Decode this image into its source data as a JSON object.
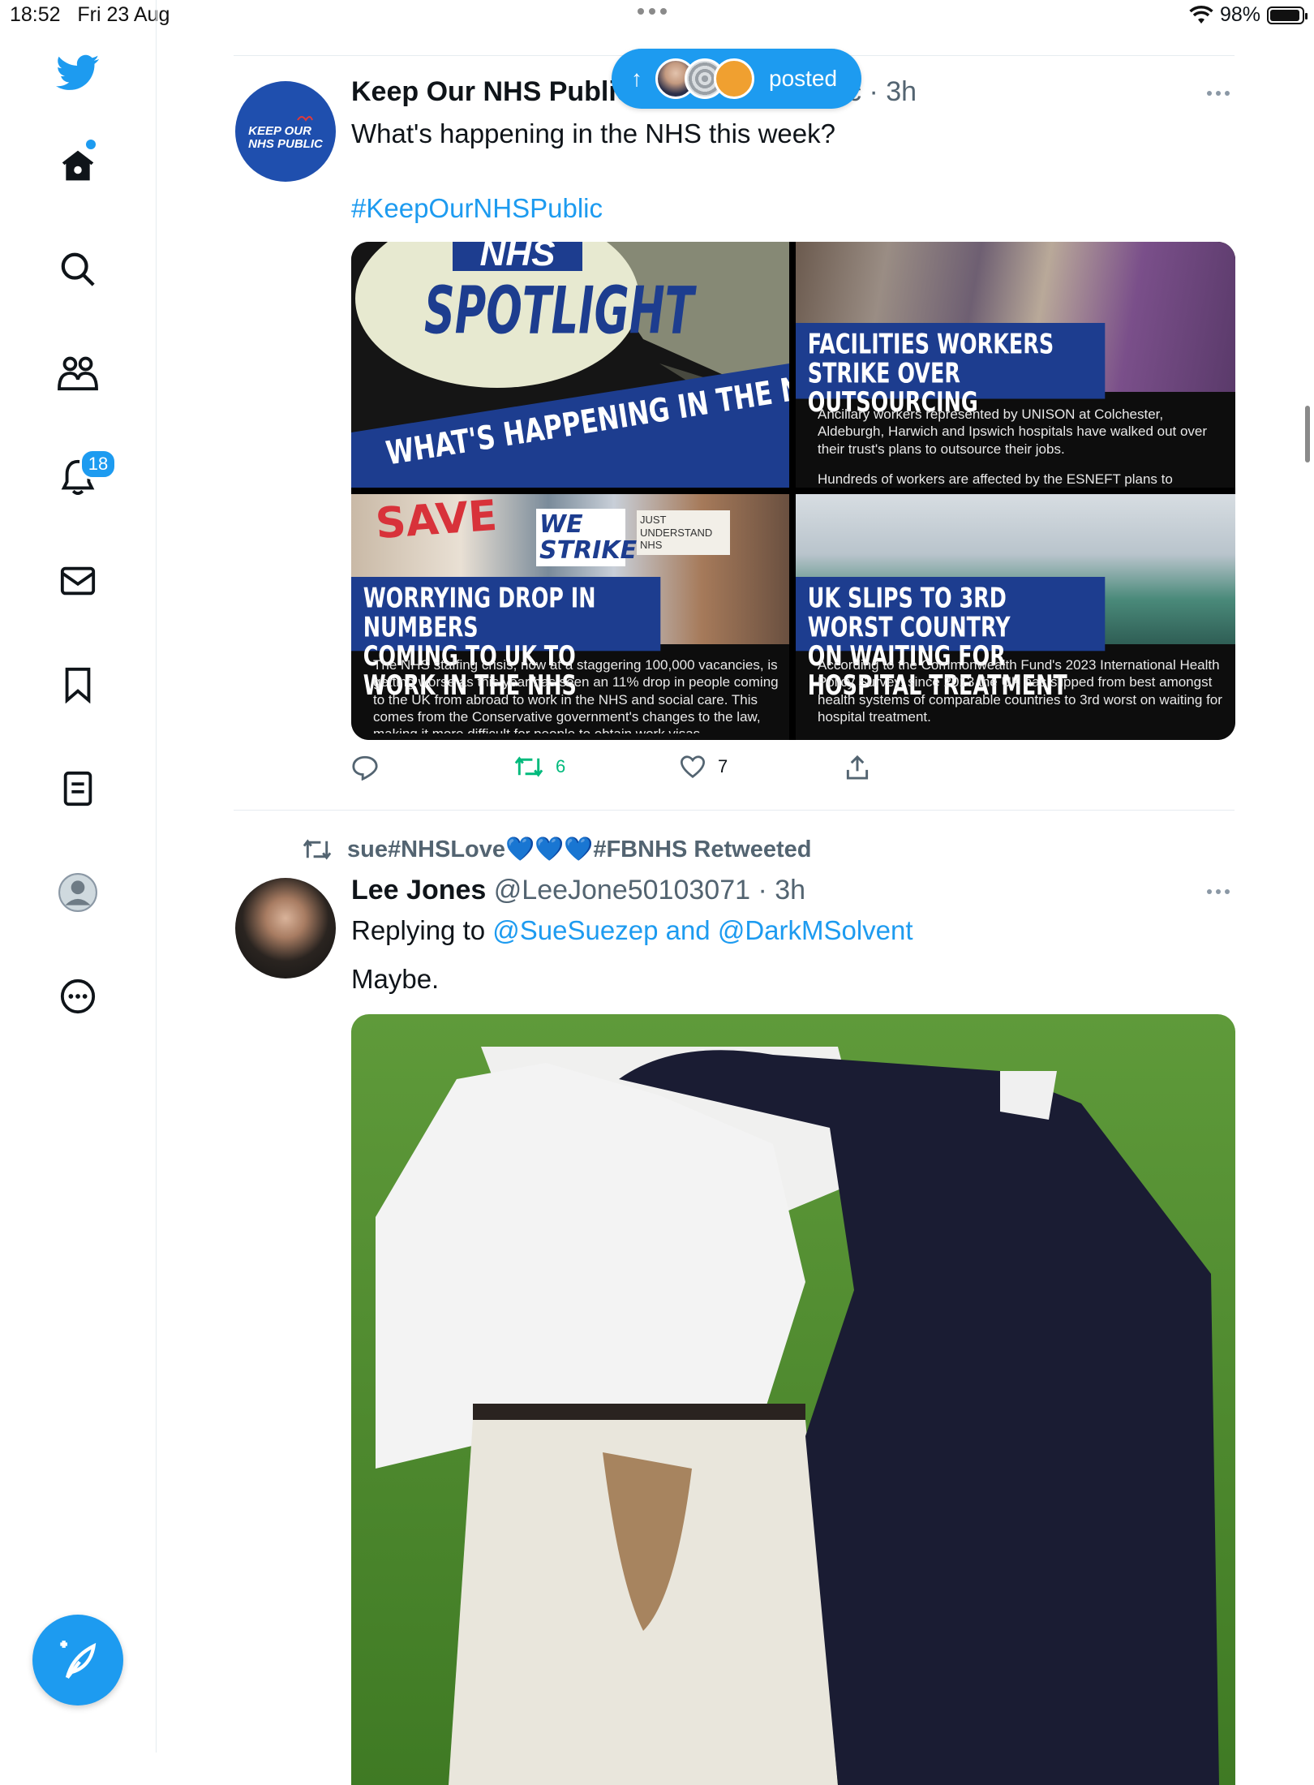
{
  "status_bar": {
    "time": "18:52",
    "date": "Fri 23 Aug",
    "battery": "98%"
  },
  "sidebar": {
    "items": [
      {
        "name": "home"
      },
      {
        "name": "explore"
      },
      {
        "name": "communities"
      },
      {
        "name": "notifications",
        "badge": "18"
      },
      {
        "name": "messages"
      },
      {
        "name": "bookmarks"
      },
      {
        "name": "lists"
      },
      {
        "name": "profile"
      },
      {
        "name": "more"
      }
    ],
    "compose_label": "Tweet"
  },
  "posted_pill": {
    "label": "posted",
    "arrow": "↑"
  },
  "tweets": [
    {
      "author": "Keep Our NHS Public",
      "handle_fragment": "c",
      "time": "3h",
      "avatar_text_line1": "KEEP OUR",
      "avatar_text_line2": "NHS PUBLIC",
      "text": "What's happening in the NHS this week?",
      "hashtag": "#KeepOurNHSPublic",
      "media": {
        "tile1_logo": "NHS",
        "tile1_title": "SPOTLIGHT",
        "tile1_banner": "WHAT'S HAPPENING IN THE NHS THIS WEEK?",
        "tile2_title_line1": "FACILITIES WORKERS",
        "tile2_title_line2": "STRIKE OVER OUTSOURCING",
        "tile2_body": "Ancillary workers represented by UNISON at Colchester, Aldeburgh, Harwich and Ipswich hospitals have walked out over their trust's plans to outsource their jobs.",
        "tile2_body2": "Hundreds of workers are affected by the ESNEFT plans to",
        "tile3_sign1": "SAVE",
        "tile3_sign2": "WE STRIKE",
        "tile3_sign3": "JUST UNDERSTAND NHS",
        "tile3_title_line1": "WORRYING DROP IN NUMBERS",
        "tile3_title_line2": "COMING TO UK TO WORK IN THE NHS",
        "tile3_body": "The NHS staffing crisis, now at a staggering 100,000 vacancies, is getting worse as this year has seen an 11% drop in people coming to the UK from abroad to work in the NHS and social care. This comes from the Conservative government's changes to the law, making it more difficult for people to obtain work visas.",
        "tile4_title_line1": "UK SLIPS TO 3RD WORST COUNTRY",
        "tile4_title_line2": "ON WAITING FOR HOSPITAL TREATMENT",
        "tile4_body": "According to the Commonwealth Fund's 2023 International Health Policy Survey, since 2013 the UK has slipped from best amongst health systems of comparable countries to 3rd worst on waiting for hospital treatment."
      },
      "actions": {
        "replies": "",
        "retweets": "6",
        "likes": "7"
      }
    },
    {
      "retweeted_by": "sue#NHSLove💙💙💙#FBNHS Retweeted",
      "author": "Lee Jones",
      "handle": "@LeeJone50103071",
      "time": "3h",
      "replying_prefix": "Replying to",
      "replying_to": "@SueSuezep and @DarkMSolvent",
      "text": "Maybe."
    }
  ],
  "colors": {
    "accent": "#1d9bf0",
    "retweet_green": "#00ba7c",
    "nhs_blue": "#1d3d8f"
  }
}
